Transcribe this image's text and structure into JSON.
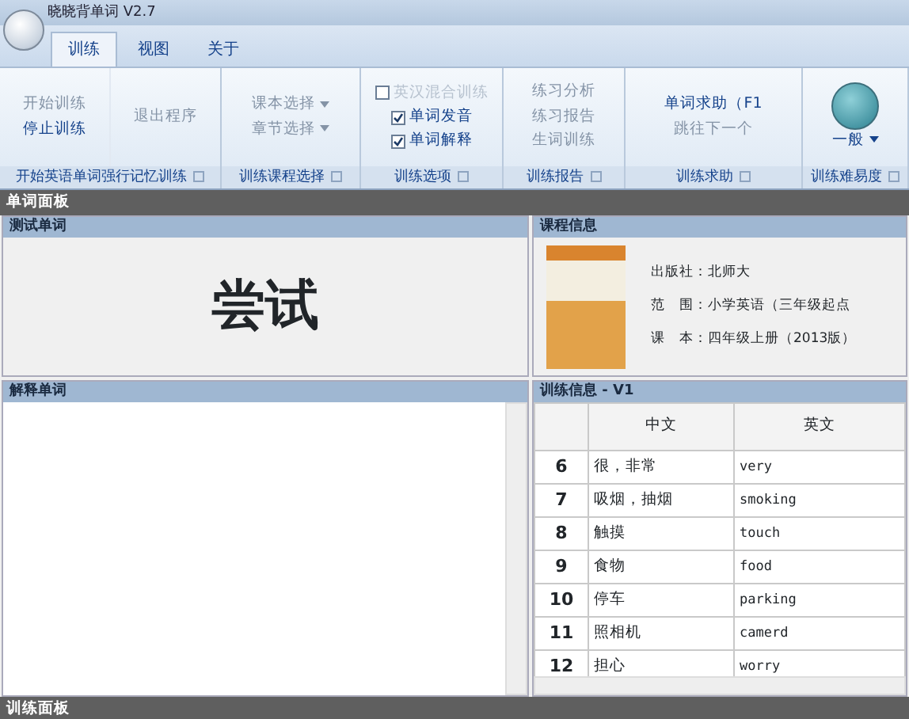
{
  "window": {
    "title": "晓晓背单词 V2.7"
  },
  "tabs": [
    {
      "label": "训练",
      "selected": true
    },
    {
      "label": "视图",
      "selected": false
    },
    {
      "label": "关于",
      "selected": false
    }
  ],
  "ribbon": {
    "groups": [
      {
        "label": "开始英语单词强行记忆训练",
        "columns": [
          [
            {
              "kind": "button",
              "label": "开始训练",
              "disabled": true
            },
            {
              "kind": "button",
              "label": "停止训练",
              "disabled": false
            }
          ],
          [
            {
              "kind": "button",
              "label": "退出程序",
              "disabled": true
            }
          ]
        ]
      },
      {
        "label": "训练课程选择",
        "columns": [
          [
            {
              "kind": "dropdown",
              "label": "课本选择",
              "disabled": true
            },
            {
              "kind": "dropdown",
              "label": "章节选择",
              "disabled": true
            }
          ]
        ]
      },
      {
        "label": "训练选项",
        "columns": [
          [
            {
              "kind": "checkbox",
              "label": "英汉混合训练",
              "checked": false,
              "disabled": true
            },
            {
              "kind": "checkbox",
              "label": "单词发音",
              "checked": true,
              "disabled": false
            },
            {
              "kind": "checkbox",
              "label": "单词解释",
              "checked": true,
              "disabled": false
            }
          ]
        ]
      },
      {
        "label": "训练报告",
        "columns": [
          [
            {
              "kind": "button",
              "label": "练习分析",
              "disabled": true
            },
            {
              "kind": "button",
              "label": "练习报告",
              "disabled": true
            },
            {
              "kind": "button",
              "label": "生词训练",
              "disabled": true
            }
          ]
        ]
      },
      {
        "label": "训练求助",
        "columns": [
          [
            {
              "kind": "button",
              "label": "单词求助（F1",
              "disabled": false
            },
            {
              "kind": "button",
              "label": "跳往下一个",
              "disabled": true
            }
          ]
        ]
      },
      {
        "label": "训练难易度",
        "columns": [
          [
            {
              "kind": "large",
              "label": "一般",
              "disabled": false
            }
          ]
        ]
      }
    ]
  },
  "word_panel": {
    "title": "单词面板",
    "test_word": {
      "title": "测试单词",
      "word": "尝试"
    },
    "course_info": {
      "title": "课程信息",
      "lines": [
        {
          "label": "出版社：",
          "value": "北师大"
        },
        {
          "label": "范　围：",
          "value": "小学英语（三年级起点"
        },
        {
          "label": "课　本：",
          "value": "四年级上册（2013版）"
        }
      ]
    },
    "explanation": {
      "title": "解释单词"
    },
    "training_info": {
      "title": "训练信息 - V1",
      "columns": [
        "中文",
        "英文"
      ],
      "rows": [
        {
          "index": "6",
          "zh": "很，非常",
          "en": "very"
        },
        {
          "index": "7",
          "zh": "吸烟，抽烟",
          "en": "smoking"
        },
        {
          "index": "8",
          "zh": "触摸",
          "en": "touch"
        },
        {
          "index": "9",
          "zh": "食物",
          "en": "food"
        },
        {
          "index": "10",
          "zh": "停车",
          "en": "parking"
        },
        {
          "index": "11",
          "zh": "照相机",
          "en": "camerd"
        },
        {
          "index": "12",
          "zh": "担心",
          "en": "worry"
        }
      ]
    }
  },
  "bottom_panel": {
    "title": "训练面板"
  }
}
